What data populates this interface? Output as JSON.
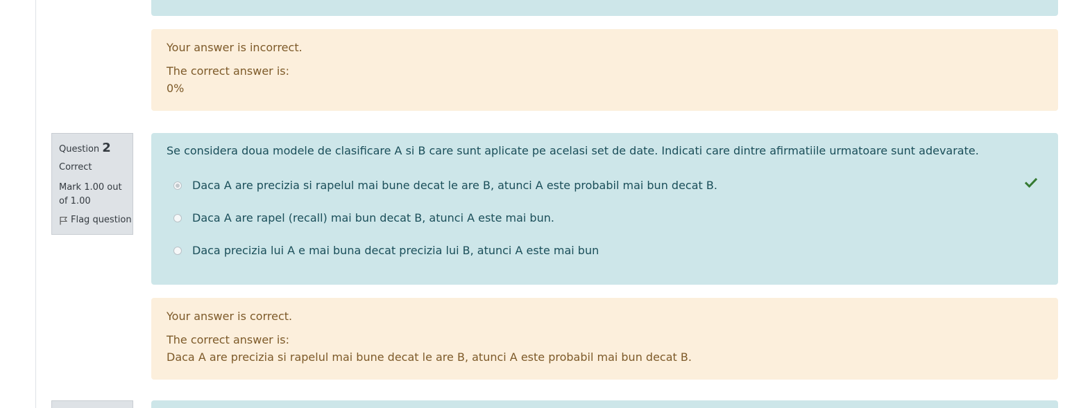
{
  "question1": {
    "feedback": {
      "outcome": "Your answer is incorrect.",
      "right_answer_label": "The correct answer is:",
      "right_answer_value": "0%"
    }
  },
  "question2": {
    "info": {
      "label": "Question",
      "number": "2",
      "state": "Correct",
      "grade": "Mark 1.00 out of 1.00",
      "flag_label": "Flag question"
    },
    "text": "Se considera doua modele de clasificare A si B care sunt aplicate pe acelasi set de date. Indicati care dintre afirmatiile urmatoare sunt adevarate.",
    "answers": [
      {
        "label": "Daca A are precizia si rapelul mai bune decat le are B, atunci A este probabil mai bun decat B.",
        "selected": true,
        "correct": true
      },
      {
        "label": "Daca A are rapel (recall) mai bun decat B, atunci A este mai bun.",
        "selected": false,
        "correct": false
      },
      {
        "label": "Daca precizia lui A e mai buna decat precizia lui B, atunci A este mai bun",
        "selected": false,
        "correct": false
      }
    ],
    "feedback": {
      "outcome": "Your answer is correct.",
      "right_answer_label": "The correct answer is:",
      "right_answer_value": "Daca A are precizia si rapelul mai bune decat le are B, atunci A este probabil mai bun decat B."
    }
  },
  "colors": {
    "formulation_bg": "#cde6e9",
    "feedback_bg": "#fcefdc",
    "feedback_text": "#7d5a29",
    "formulation_text": "#1a4e59",
    "check_green": "#357a32",
    "info_bg": "#dee2e6"
  },
  "icons": {
    "flag": "flag-icon",
    "correct": "check-icon"
  }
}
